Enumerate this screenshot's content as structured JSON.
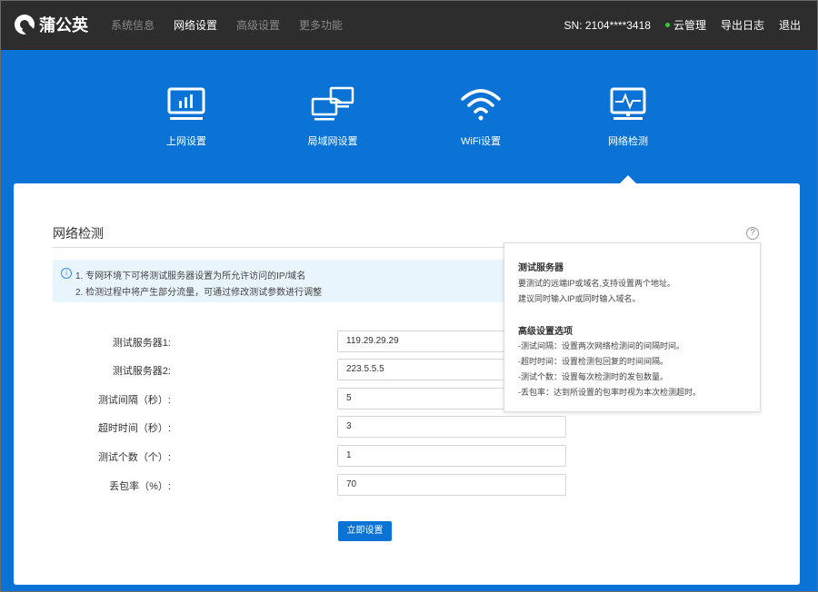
{
  "header": {
    "logo_text": "蒲公英",
    "nav": [
      {
        "label": "系统信息",
        "active": false
      },
      {
        "label": "网络设置",
        "active": true
      },
      {
        "label": "高级设置",
        "active": false
      },
      {
        "label": "更多功能",
        "active": false
      }
    ],
    "sn": "SN:  2104****3418",
    "cloud_label": "云管理",
    "export_log": "导出日志",
    "logout": "退出"
  },
  "mainnav": {
    "items": [
      {
        "label": "上网设置",
        "icon": "monitor-chart-icon"
      },
      {
        "label": "局域网设置",
        "icon": "lan-computers-icon"
      },
      {
        "label": "WiFi设置",
        "icon": "wifi-icon"
      },
      {
        "label": "网络检测",
        "icon": "monitor-pulse-icon",
        "active": true
      }
    ]
  },
  "card": {
    "title": "网络检测",
    "help_icon": "?",
    "info": {
      "line1": "1. 专网环境下可将测试服务器设置为所允许访问的IP/域名",
      "line2": "2. 检测过程中将产生部分流量，可通过修改测试参数进行调整"
    },
    "form": [
      {
        "label": "测试服务器1:",
        "value": "119.29.29.29"
      },
      {
        "label": "测试服务器2:",
        "value": "223.5.5.5"
      },
      {
        "label": "测试间隔（秒）:",
        "value": "5"
      },
      {
        "label": "超时时间（秒）:",
        "value": "3"
      },
      {
        "label": "测试个数（个）:",
        "value": "1"
      },
      {
        "label": "丢包率（%）:",
        "value": "70"
      }
    ],
    "submit": "立即设置"
  },
  "tooltip": {
    "h1": "测试服务器",
    "t1": "要测试的远端IP或域名,支持设置两个地址。",
    "t2": "建议同时输入IP或同时输入域名。",
    "h2": "高级设置选项",
    "t3": "-测试间隔：设置两次网络检测间的间隔时间。",
    "t4": "-超时时间：设置检测包回复的时间间隔。",
    "t5": "-测试个数：设置每次检测时的发包数量。",
    "t6": "-丢包率：达到所设置的包率时视为本次检测超时。"
  },
  "colors": {
    "accent": "#0b73d6",
    "topbar": "#2d2d2d",
    "status_dot": "#2ecc40"
  }
}
